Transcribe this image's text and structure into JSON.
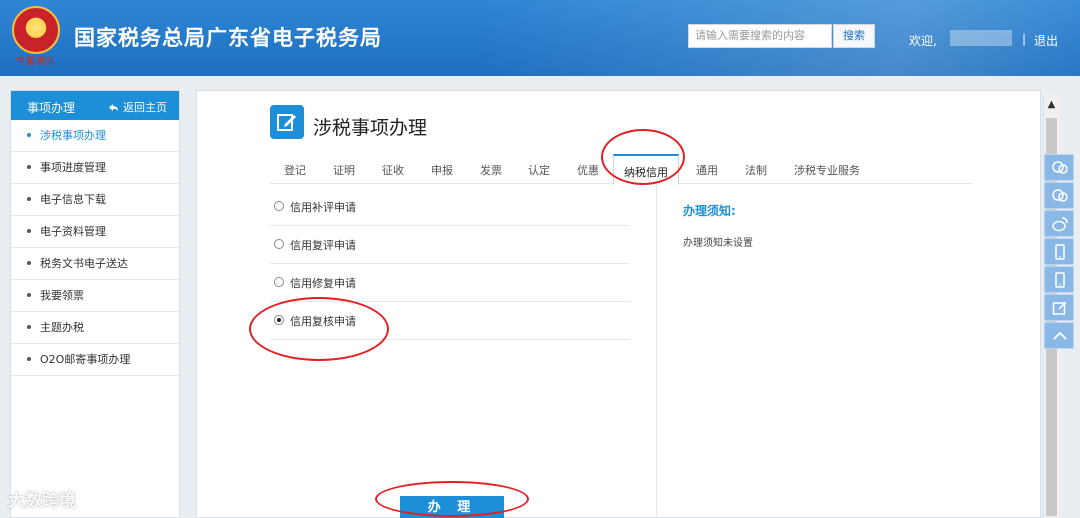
{
  "header": {
    "title": "国家税务总局广东省电子税务局",
    "seal_text": "中国税务",
    "search_placeholder": "请输入需要搜索的内容",
    "search_button": "搜索",
    "welcome": "欢迎,",
    "separator": "|",
    "logout": "退出"
  },
  "sidebar": {
    "title": "事项办理",
    "back": "返回主页",
    "items": [
      {
        "label": "涉税事项办理",
        "active": true
      },
      {
        "label": "事项进度管理"
      },
      {
        "label": "电子信息下载"
      },
      {
        "label": "电子资料管理"
      },
      {
        "label": "税务文书电子送达"
      },
      {
        "label": "我要领票"
      },
      {
        "label": "主题办税"
      },
      {
        "label": "O2O邮寄事项办理"
      }
    ]
  },
  "main": {
    "title": "涉税事项办理",
    "tabs": [
      "登记",
      "证明",
      "征收",
      "申报",
      "发票",
      "认定",
      "优惠",
      "纳税信用",
      "通用",
      "法制",
      "涉税专业服务"
    ],
    "active_tab": "纳税信用",
    "options": [
      {
        "label": "信用补评申请",
        "selected": false
      },
      {
        "label": "信用复评申请",
        "selected": false
      },
      {
        "label": "信用修复申请",
        "selected": false
      },
      {
        "label": "信用复核申请",
        "selected": true
      }
    ],
    "notice_title": "办理须知:",
    "notice_body": "办理须知未设置",
    "submit_label": "办 理"
  },
  "scrollbar": {
    "up_arrow": "▲"
  },
  "float_toolbar": [
    "chat-icon",
    "chat-icon",
    "weibo-icon",
    "mobile-icon",
    "mobile-icon",
    "edit-icon",
    "arrow-up-icon"
  ],
  "watermark": "大数跨境",
  "colors": {
    "header_blue": "#1d6fc0",
    "accent": "#1d8fd8",
    "annotation": "#e22024"
  }
}
